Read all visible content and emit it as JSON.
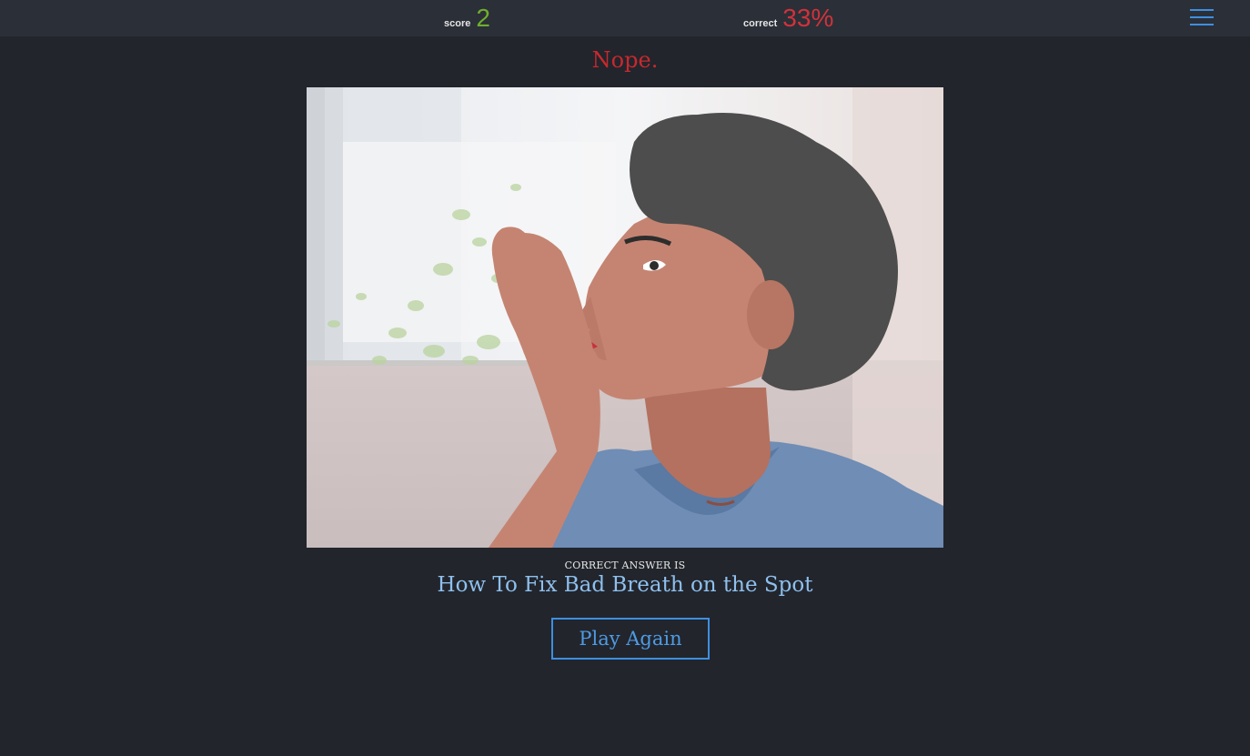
{
  "header": {
    "score_label": "score",
    "score_value": "2",
    "correct_label": "correct",
    "correct_value": "33%",
    "menu_icon": "hamburger-menu-icon"
  },
  "result": {
    "verdict": "Nope.",
    "answer_caption": "CORRECT ANSWER IS",
    "answer_title": "How To Fix Bad Breath on the Spot",
    "play_again_label": "Play Again"
  },
  "colors": {
    "background": "#22252c",
    "topbar": "#2b2f37",
    "score": "#6fae2e",
    "correct": "#d0323b",
    "accent": "#3e8fe0"
  }
}
